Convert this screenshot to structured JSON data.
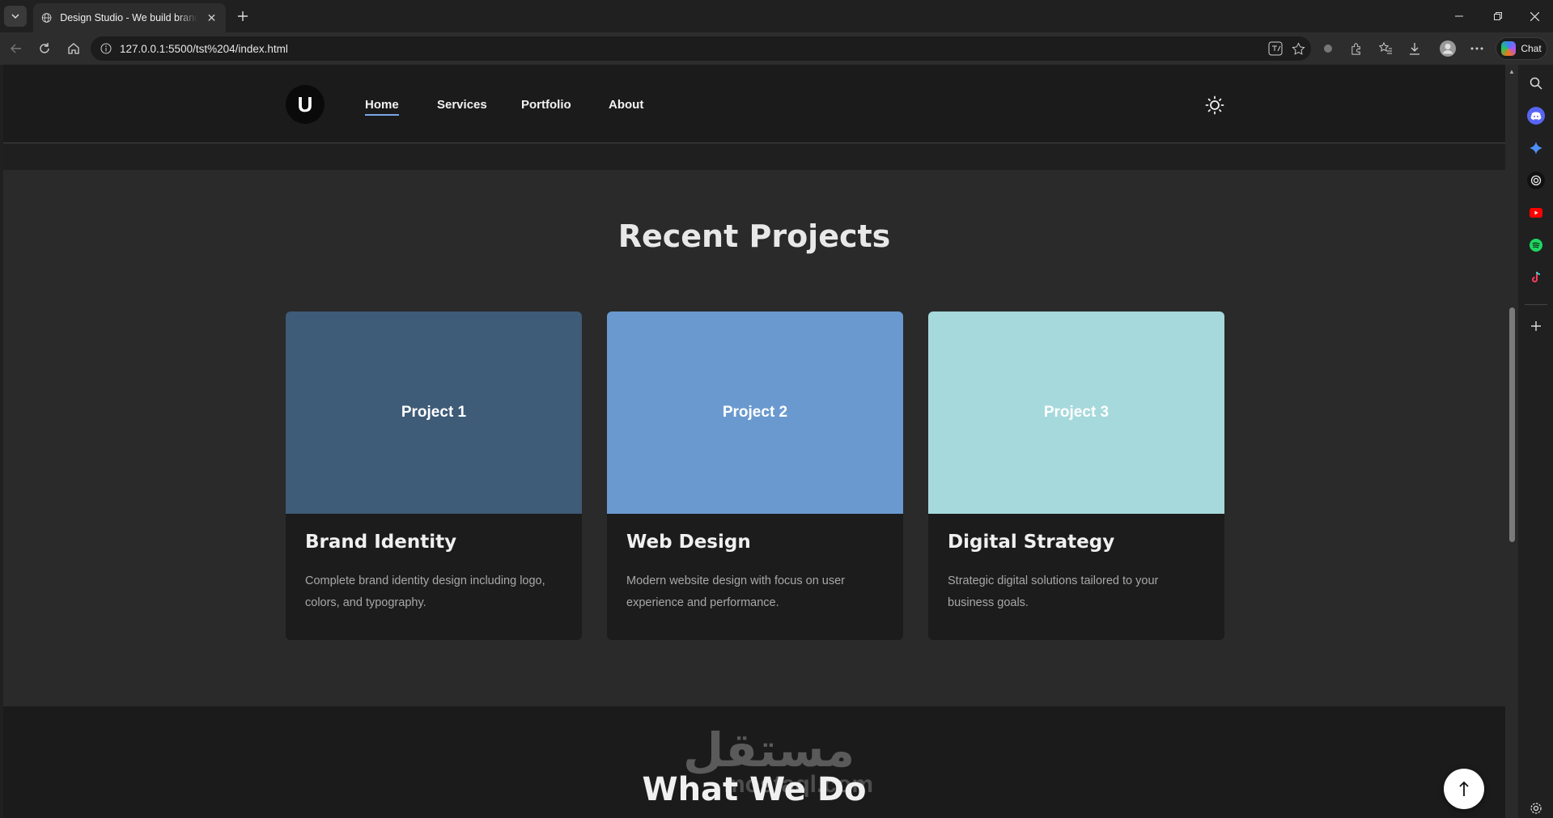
{
  "browser": {
    "tab_title": "Design Studio - We build brands for",
    "address": "127.0.0.1:5500/tst%204/index.html",
    "chat_label": "Chat"
  },
  "site": {
    "logo_letter": "U",
    "nav": [
      {
        "label": "Home",
        "active": true
      },
      {
        "label": "Services",
        "active": false
      },
      {
        "label": "Portfolio",
        "active": false
      },
      {
        "label": "About",
        "active": false
      }
    ]
  },
  "projects": {
    "title": "Recent Projects",
    "cards": [
      {
        "image_label": "Project 1",
        "image_color": "#3e5b78",
        "title": "Brand Identity",
        "description": "Complete brand identity design including logo, colors, and typography."
      },
      {
        "image_label": "Project 2",
        "image_color": "#6a99cf",
        "title": "Web Design",
        "description": "Modern website design with focus on user experience and performance."
      },
      {
        "image_label": "Project 3",
        "image_color": "#a6d9db",
        "title": "Digital Strategy",
        "description": "Strategic digital solutions tailored to your business goals."
      }
    ]
  },
  "services": {
    "title": "What We Do"
  },
  "watermark": {
    "arabic": "مستقل",
    "latin": "mostaql.com"
  },
  "icons": {
    "scroll_top": "arrow-up-icon",
    "theme": "sun-icon"
  },
  "colors": {
    "accent": "#7aa6e8",
    "header_bg": "#1b1b1b",
    "section_bg": "#2a2a2a",
    "card_bg": "#1c1c1c"
  }
}
